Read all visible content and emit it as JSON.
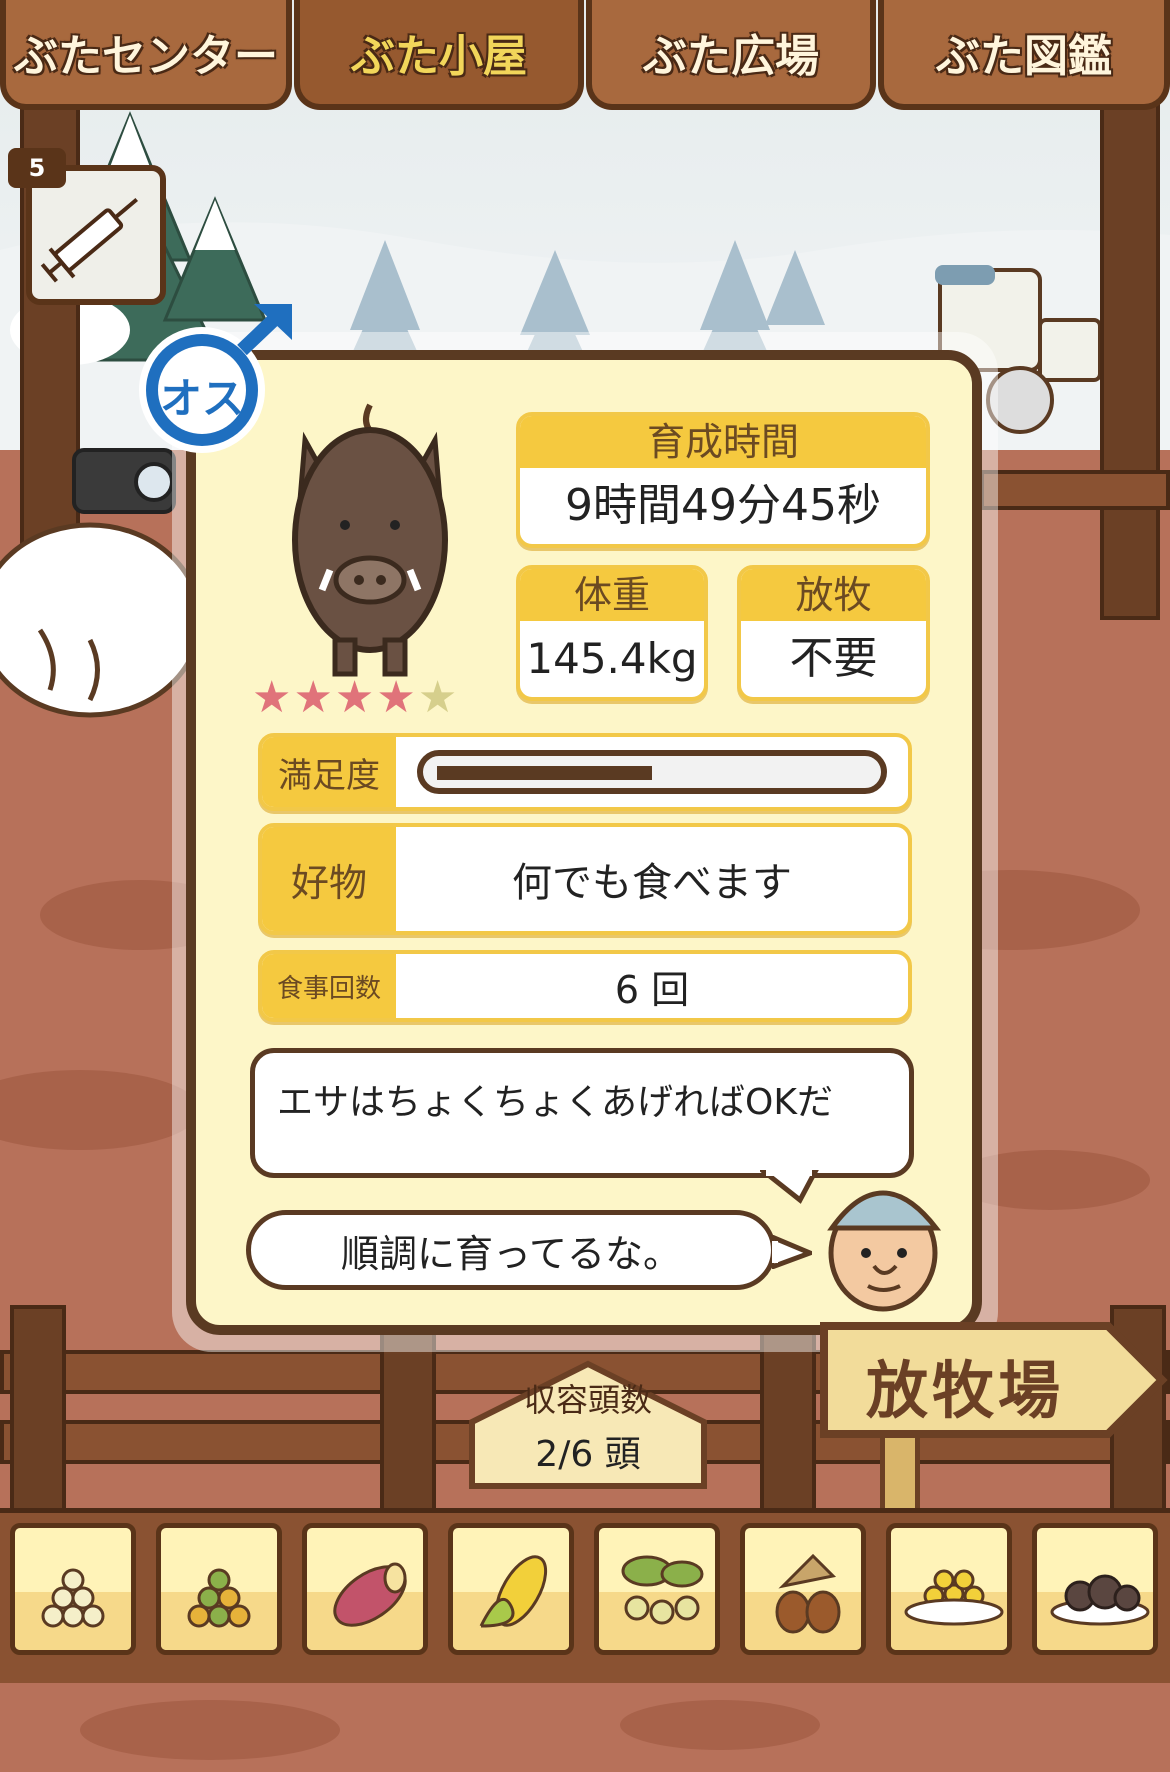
{
  "tabs": [
    {
      "label": "ぶたセンター",
      "active": false
    },
    {
      "label": "ぶた小屋",
      "active": true
    },
    {
      "label": "ぶた広場",
      "active": false
    },
    {
      "label": "ぶた図鑑",
      "active": false
    }
  ],
  "item": {
    "count": "5",
    "icon": "syringe-icon"
  },
  "pig": {
    "gender_label": "オス",
    "gender_icon": "male-symbol-icon",
    "rating": 4,
    "rating_max": 5,
    "rearing_time": {
      "label": "育成時間",
      "value": "9時間49分45秒"
    },
    "weight": {
      "label": "体重",
      "value": "145.4kg"
    },
    "grazing": {
      "label": "放牧",
      "value": "不要"
    },
    "satisfaction": {
      "label": "満足度",
      "level": 0.5
    },
    "favorite": {
      "label": "好物",
      "value": "何でも食べます"
    },
    "meals": {
      "label": "食事回数",
      "value": "6 回"
    }
  },
  "tip_message": "エサはちょくちょくあげればOKだ",
  "status_message": "順調に育ってるな。",
  "capacity": {
    "label": "収容頭数",
    "value": "2/6 頭"
  },
  "pasture_sign": "放牧場",
  "foods": [
    "grain-pile-icon",
    "mixed-beans-icon",
    "sweet-potato-icon",
    "corn-icon",
    "leafy-berries-icon",
    "acorns-icon",
    "bowl-of-grains-icon",
    "truffle-plate-icon"
  ],
  "colors": {
    "panel_bg": "#fdf6c8",
    "accent_yellow": "#f5c93f",
    "frame_brown": "#5a3a22",
    "male_blue": "#1f6fbf"
  }
}
